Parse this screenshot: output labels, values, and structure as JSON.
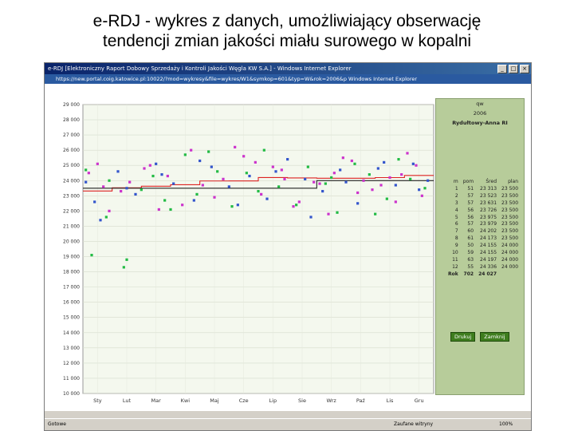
{
  "slide": {
    "title_line1": "e-RDJ - wykres z danych, umożliwiający obserwację",
    "title_line2": "tendencji zmian jakości miału surowego w kopalni"
  },
  "window": {
    "title": "e-RDJ [Elektroniczny Raport Dobowy Sprzedaży i Kontroli Jakości Węgla KW S.A.] - Windows Internet Explorer",
    "url_bar": "https://new.portal.coig.katowice.pl:10022/?mod=wykresy&file=wykres/W1&symkop=601&typ=W&rok=2006&p  Windows Internet Explorer",
    "status_left": "Gotowe",
    "status_mid": "Zaufane witryny",
    "status_right": "100%"
  },
  "side_panel": {
    "header_typ": "qw",
    "header_year": "2006",
    "header_mine": "Rydułtowy-Anna RI",
    "columns": [
      "m",
      "pom",
      "Śred",
      "plan"
    ],
    "rows": [
      [
        "1",
        "51",
        "23 313",
        "23 500"
      ],
      [
        "2",
        "57",
        "23 523",
        "23 500"
      ],
      [
        "3",
        "57",
        "23 631",
        "23 500"
      ],
      [
        "4",
        "56",
        "23 726",
        "23 500"
      ],
      [
        "5",
        "56",
        "23 975",
        "23 500"
      ],
      [
        "6",
        "57",
        "23 979",
        "23 500"
      ],
      [
        "7",
        "60",
        "24 202",
        "23 500"
      ],
      [
        "8",
        "61",
        "24 173",
        "23 500"
      ],
      [
        "9",
        "50",
        "24 155",
        "24 000"
      ],
      [
        "10",
        "59",
        "24 155",
        "24 000"
      ],
      [
        "11",
        "63",
        "24 197",
        "24 000"
      ],
      [
        "12",
        "55",
        "24 336",
        "24 000"
      ]
    ],
    "total_label": "Rok",
    "total_pom": "702",
    "total_avg": "24 027",
    "btn_print": "Drukuj",
    "btn_close": "Zamknij"
  },
  "chart_data": {
    "type": "scatter",
    "title": "",
    "xlabel": "",
    "ylabel": "",
    "categories": [
      "Sty",
      "Lut",
      "Mar",
      "Kwi",
      "Maj",
      "Cze",
      "Lip",
      "Sie",
      "Wrz",
      "Paź",
      "Lis",
      "Gru"
    ],
    "yticks": [
      "29 000",
      "28 000",
      "27 000",
      "26 000",
      "25 000",
      "24 000",
      "23 000",
      "22 000",
      "21 000",
      "20 000",
      "19 000",
      "18 000",
      "17 000",
      "16 000",
      "15 000",
      "14 000",
      "13 000",
      "12 000",
      "11 000",
      "10 000"
    ],
    "ylim": [
      10000,
      29000
    ],
    "grid": true,
    "colors": {
      "magenta": "#cc33cc",
      "blue": "#3355cc",
      "green": "#22bb44",
      "red": "#dd2222",
      "black": "#222222",
      "plot_bg": "#f4f8ee",
      "panel_bg": "#b7cc9a"
    },
    "series": [
      {
        "color": "#cc33cc",
        "x": [
          0.2,
          0.9,
          1.6,
          2.3,
          2.9,
          3.4,
          4.1,
          4.8,
          5.5,
          6.1,
          6.8,
          7.4,
          7.9,
          8.6,
          9.2,
          9.9,
          10.5,
          11.1,
          11.6,
          0.5,
          1.3,
          2.1,
          3.7,
          4.5,
          5.9,
          6.5,
          7.2,
          8.1,
          8.9,
          9.6,
          10.2,
          10.9,
          11.4,
          0.7,
          2.6,
          5.2,
          6.9,
          8.4,
          9.4,
          10.7
        ],
        "y": [
          24500,
          22000,
          23900,
          25000,
          24300,
          22400,
          23700,
          24100,
          25600,
          23100,
          24700,
          22600,
          23900,
          24500,
          25300,
          23400,
          24200,
          25800,
          23000,
          25100,
          23300,
          24800,
          26000,
          22900,
          25200,
          24900,
          22300,
          23800,
          25500,
          24000,
          23700,
          24400,
          25000,
          23600,
          22100,
          26200,
          24100,
          21800,
          23200,
          22600
        ]
      },
      {
        "color": "#3355cc",
        "x": [
          0.1,
          0.6,
          1.2,
          1.8,
          2.5,
          3.1,
          3.8,
          4.4,
          5.0,
          5.7,
          6.3,
          7.0,
          7.6,
          8.2,
          8.8,
          9.4,
          10.1,
          10.7,
          11.3,
          11.8,
          0.4,
          1.5,
          2.7,
          4.0,
          5.3,
          6.6,
          7.8,
          9.0,
          10.3,
          11.5
        ],
        "y": [
          23900,
          21400,
          24600,
          23100,
          25100,
          23800,
          22700,
          24900,
          23600,
          24300,
          22800,
          25400,
          24100,
          23300,
          24700,
          22500,
          24800,
          23700,
          25100,
          24000,
          22600,
          23500,
          24400,
          25300,
          22400,
          24600,
          21600,
          23900,
          25200,
          23400
        ]
      },
      {
        "color": "#22bb44",
        "x": [
          0.1,
          0.3,
          0.8,
          1.4,
          1.5,
          2.0,
          2.4,
          3.0,
          3.5,
          3.9,
          4.6,
          5.1,
          5.6,
          6.2,
          6.7,
          7.3,
          7.7,
          8.3,
          8.7,
          9.3,
          9.8,
          10.4,
          10.8,
          11.2,
          11.7,
          0.9,
          2.8,
          4.3,
          6.0,
          8.5,
          10.0
        ],
        "y": [
          24700,
          19100,
          21600,
          18300,
          18800,
          23400,
          24300,
          22100,
          25700,
          23100,
          24600,
          22300,
          24500,
          26000,
          23600,
          22400,
          24900,
          23800,
          21900,
          25100,
          24400,
          22800,
          25400,
          24100,
          23500,
          24000,
          22700,
          25900,
          23300,
          24200,
          21800
        ]
      }
    ],
    "trend_lines": [
      {
        "color": "#dd2222",
        "label": "",
        "y": [
          23313,
          23523,
          23631,
          23726,
          23975,
          23979,
          24202,
          24173,
          24155,
          24155,
          24197,
          24336
        ]
      },
      {
        "color": "#222222",
        "label": "",
        "y": [
          23500,
          23500,
          23500,
          23500,
          23500,
          23500,
          23500,
          23500,
          24000,
          24000,
          24000,
          24000
        ]
      }
    ]
  }
}
